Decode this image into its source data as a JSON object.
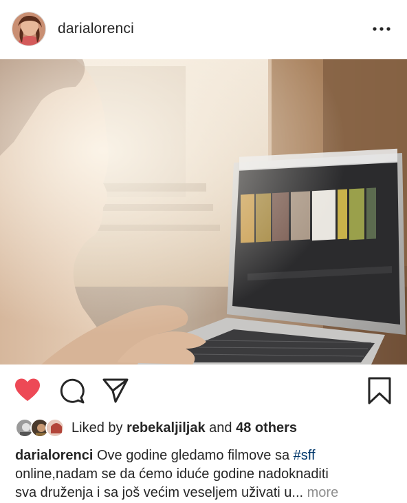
{
  "post": {
    "username": "darialorenci",
    "more_options_icon": "ellipsis-icon",
    "photo_description_icon": "photo"
  },
  "actions": {
    "like_icon": "heart-filled-icon",
    "liked": true,
    "like_color": "#ed4956",
    "comment_icon": "comment-icon",
    "share_icon": "paper-plane-icon",
    "save_icon": "bookmark-icon"
  },
  "likes": {
    "prefix": "Liked by",
    "top_liker": "rebekaljiljak",
    "and": "and",
    "others": "48 others"
  },
  "caption": {
    "username": "darialorenci",
    "text_part1": "Ove godine gledamo filmove sa",
    "hashtag": "#sff",
    "line2": "online,nadam se da ćemo iduće godine  nadoknaditi",
    "line3": "sva druženja i sa još većim veseljem uživati u...",
    "more": "more"
  }
}
